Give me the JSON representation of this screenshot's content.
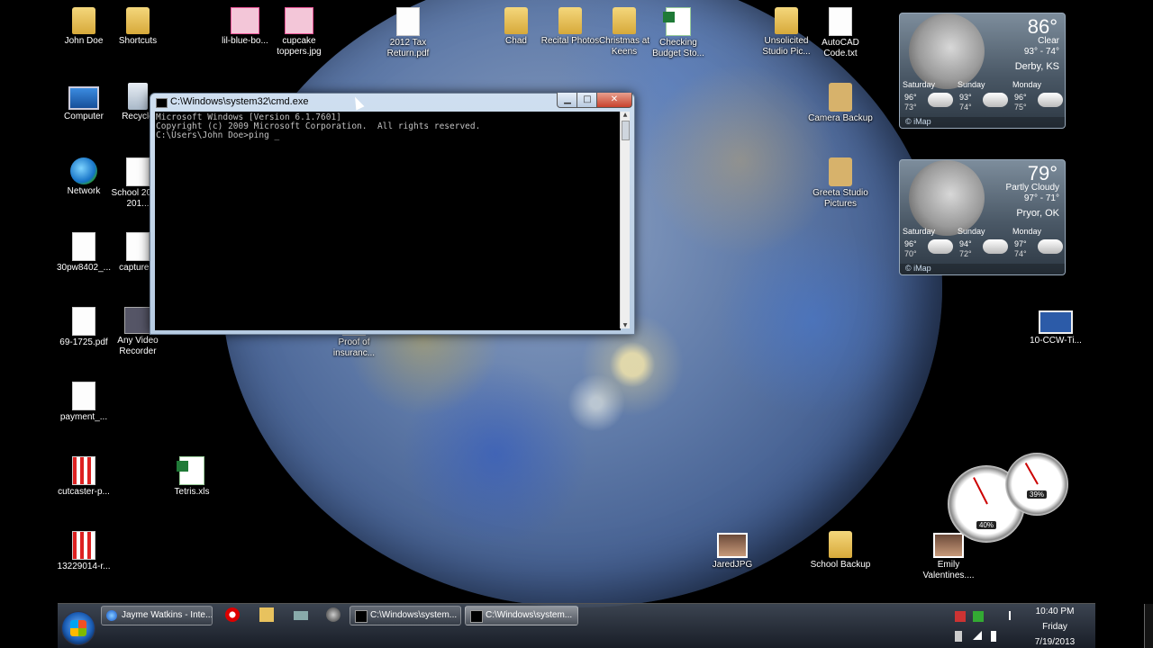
{
  "desktop_icons": [
    {
      "label": "John Doe",
      "icon": "user-folder-icon"
    },
    {
      "label": "Shortcuts",
      "icon": "folder-icon"
    },
    {
      "label": "lil-blue-bo...",
      "icon": "image-file-icon"
    },
    {
      "label": "cupcake toppers.jpg",
      "icon": "image-file-icon"
    },
    {
      "label": "2012 Tax Return.pdf",
      "icon": "pdf-file-icon"
    },
    {
      "label": "Chad",
      "icon": "folder-icon"
    },
    {
      "label": "Recital Photos",
      "icon": "folder-icon"
    },
    {
      "label": "Christmas at Keens",
      "icon": "folder-icon"
    },
    {
      "label": "Checking Budget Sto...",
      "icon": "excel-file-icon"
    },
    {
      "label": "Unsolicited Studio Pic...",
      "icon": "folder-icon"
    },
    {
      "label": "AutoCAD Code.txt",
      "icon": "text-file-icon"
    },
    {
      "label": "Computer",
      "icon": "computer-icon"
    },
    {
      "label": "Recycle",
      "icon": "recycle-bin-icon"
    },
    {
      "label": "Camera Backup",
      "icon": "folder-icon"
    },
    {
      "label": "Network",
      "icon": "network-icon"
    },
    {
      "label": "School 2012-201...",
      "icon": "document-file-icon"
    },
    {
      "label": "Greeta Studio Pictures",
      "icon": "folder-icon"
    },
    {
      "label": "30pw8402_...",
      "icon": "document-file-icon"
    },
    {
      "label": "capture...",
      "icon": "document-file-icon"
    },
    {
      "label": "69-1725.pdf",
      "icon": "pdf-file-icon"
    },
    {
      "label": "Any Video Recorder",
      "icon": "video-recorder-icon"
    },
    {
      "label": "Proof of insuranc...",
      "icon": "document-file-icon"
    },
    {
      "label": "10-CCW-Ti...",
      "icon": "gun-shortcut-icon"
    },
    {
      "label": "payment_...",
      "icon": "document-file-icon"
    },
    {
      "label": "cutcaster-p...",
      "icon": "image-file-icon"
    },
    {
      "label": "Tetris.xls",
      "icon": "excel-file-icon"
    },
    {
      "label": "13229014-r...",
      "icon": "image-file-icon"
    },
    {
      "label": "JaredJPG",
      "icon": "photo-file-icon"
    },
    {
      "label": "School Backup",
      "icon": "folder-icon"
    },
    {
      "label": "Emily Valentines....",
      "icon": "photo-file-icon"
    }
  ],
  "cmd_window": {
    "title": "C:\\Windows\\system32\\cmd.exe",
    "console_lines": [
      "Microsoft Windows [Version 6.1.7601]",
      "Copyright (c) 2009 Microsoft Corporation.  All rights reserved.",
      "",
      "C:\\Users\\John Doe>ping _"
    ]
  },
  "weather": [
    {
      "temp": "86°",
      "condition": "Clear",
      "hilo": "93° - 74°",
      "city": "Derby, KS",
      "forecast": [
        {
          "day": "Saturday",
          "hi": "96°",
          "lo": "73°"
        },
        {
          "day": "Sunday",
          "hi": "93°",
          "lo": "74°"
        },
        {
          "day": "Monday",
          "hi": "96°",
          "lo": "75°"
        }
      ],
      "footer": "© iMap"
    },
    {
      "temp": "79°",
      "condition": "Partly Cloudy",
      "hilo": "97° - 71°",
      "city": "Pryor, OK",
      "forecast": [
        {
          "day": "Saturday",
          "hi": "96°",
          "lo": "70°"
        },
        {
          "day": "Sunday",
          "hi": "94°",
          "lo": "72°"
        },
        {
          "day": "Monday",
          "hi": "97°",
          "lo": "74°"
        }
      ],
      "footer": "© iMap"
    }
  ],
  "cpu_meter": {
    "cpu_percent": "40%",
    "memory_percent": "39%",
    "cpu_value": 0.4,
    "memory_value": 0.39
  },
  "taskbar": {
    "buttons": [
      {
        "label": "Jayme Watkins - Inte...",
        "icon": "internet-explorer-icon",
        "active": false
      },
      {
        "label": "C:\\Windows\\system...",
        "icon": "cmd-icon",
        "active": false
      },
      {
        "label": "C:\\Windows\\system...",
        "icon": "cmd-icon",
        "active": true
      }
    ],
    "pinned": [
      "opera-icon",
      "explorer-folder-icon",
      "keyboard-icon",
      "media-player-icon"
    ],
    "clock": {
      "time": "10:40 PM",
      "day": "Friday",
      "date": "7/19/2013"
    }
  },
  "colors": {
    "console_bg": "#000000",
    "console_text": "#c0c0c0",
    "taskbar": "#2a303a"
  }
}
